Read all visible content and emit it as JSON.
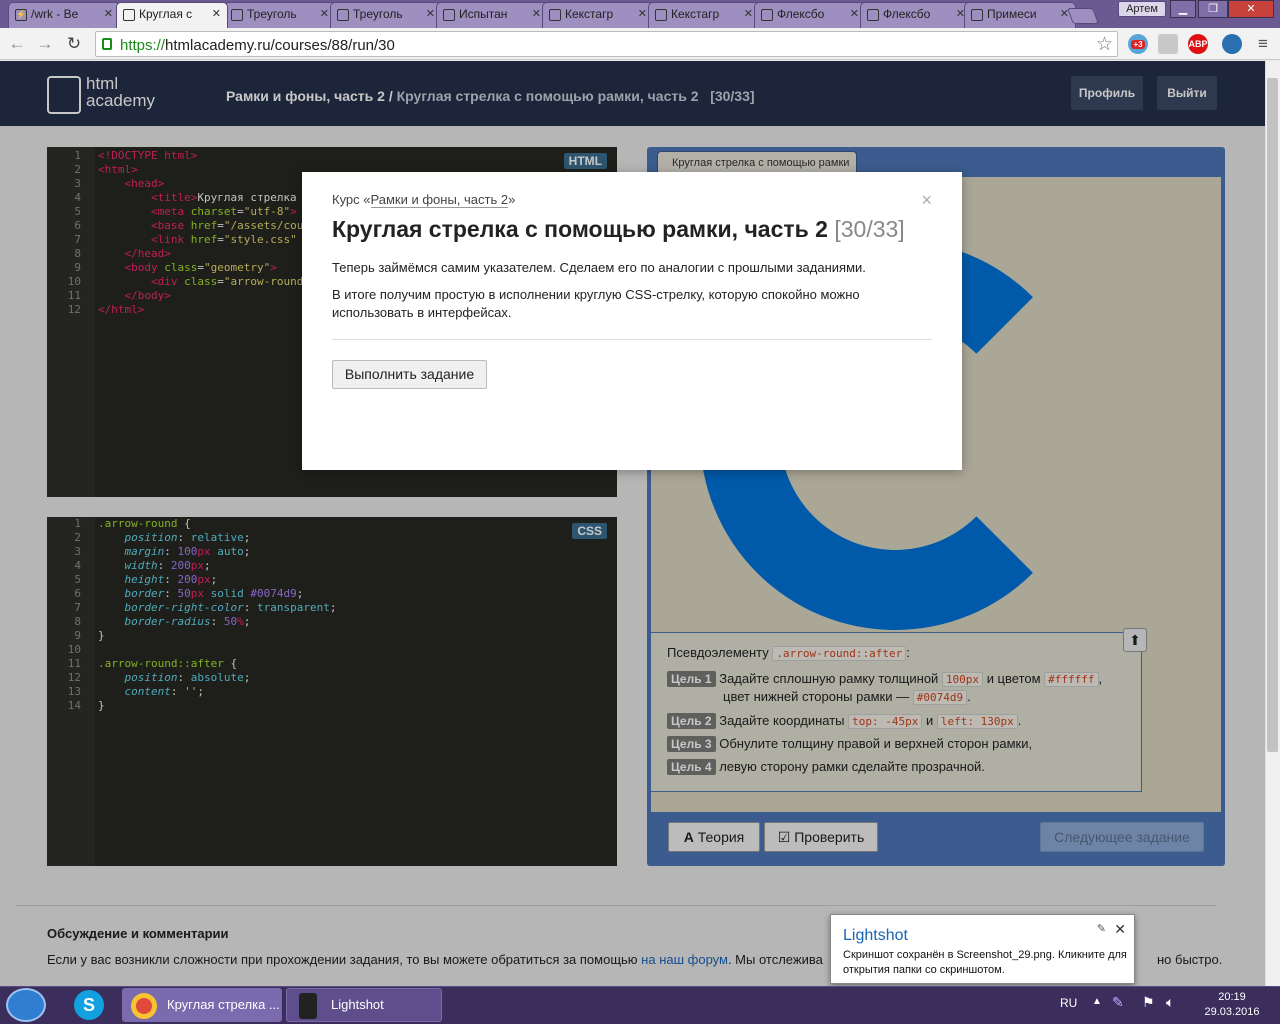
{
  "browser": {
    "tabs": [
      {
        "title": "/wrk - Ве"
      },
      {
        "title": "Круглая с",
        "active": true
      },
      {
        "title": "Треуголь"
      },
      {
        "title": "Треуголь"
      },
      {
        "title": "Испытан"
      },
      {
        "title": "Кекстагр"
      },
      {
        "title": "Кекстагр"
      },
      {
        "title": "Флексбо"
      },
      {
        "title": "Флексбо"
      },
      {
        "title": "Примеси"
      }
    ],
    "user_label": "Артем",
    "url_scheme": "https://",
    "url_rest": "htmlacademy.ru/courses/88/run/30",
    "ext_badge": "+3",
    "abp_label": "ABP"
  },
  "site": {
    "logo_line1": "html",
    "logo_line2": "academy",
    "breadcrumb_course": "Рамки и фоны, часть 2",
    "breadcrumb_sep": " / ",
    "breadcrumb_task": "Круглая стрелка с помощью рамки, часть 2",
    "breadcrumb_count": "[30/33]",
    "profile_button": "Профиль",
    "logout_button": "Выйти"
  },
  "html_editor": {
    "lang": "HTML",
    "line_numbers": [
      "1",
      "2",
      "3",
      "4",
      "5",
      "6",
      "7",
      "8",
      "9",
      "10",
      "11",
      "12"
    ]
  },
  "css_editor": {
    "lang": "CSS",
    "line_numbers": [
      "1",
      "2",
      "3",
      "4",
      "5",
      "6",
      "7",
      "8",
      "9",
      "10",
      "11",
      "12",
      "13",
      "14"
    ]
  },
  "preview": {
    "tab_label": "Круглая стрелка с помощью рамки",
    "arrow_color": "#0074d9",
    "intro_text": "Псевдоэлементу",
    "intro_code": ".arrow-round::after",
    "intro_tail": ":",
    "goals": [
      {
        "label": "Цель 1",
        "text1": "Задайте сплошную рамку толщиной",
        "code1": "100px",
        "text2": "и цветом",
        "code2": "#ffffff",
        "text3": ",",
        "line2_text": "цвет нижней стороны рамки —",
        "line2_code": "#0074d9",
        "line2_tail": "."
      },
      {
        "label": "Цель 2",
        "text1": "Задайте координаты",
        "code1": "top: -45px",
        "text2": "и",
        "code2": "left: 130px",
        "text3": "."
      },
      {
        "label": "Цель 3",
        "text1": "Обнулите толщину правой и верхней сторон рамки,"
      },
      {
        "label": "Цель 4",
        "text1": "левую сторону рамки сделайте прозрачной."
      }
    ],
    "theory_button": "Теория",
    "check_button": "Проверить",
    "next_button": "Следующее задание"
  },
  "discussion": {
    "heading": "Обсуждение и комментарии",
    "text_start": "Если у вас возникли сложности при прохождении задания, то вы можете обратиться за помощью",
    "link": "на наш форум",
    "text_end": ". Мы отслежива",
    "text_tail": "но быстро."
  },
  "modal": {
    "course_prefix": "Курс «",
    "course_name": "Рамки и фоны, часть 2",
    "course_suffix": "»",
    "title": "Круглая стрелка с помощью рамки, часть 2",
    "count": "[30/33]",
    "para1": "Теперь займёмся самим указателем. Сделаем его по аналогии с прошлыми заданиями.",
    "para2": "В итоге получим простую в исполнении круглую CSS-стрелку, которую спокойно можно использовать в интерфейсах.",
    "button": "Выполнить задание",
    "close": "×"
  },
  "lightshot": {
    "title": "Lightshot",
    "message": "Скриншот сохранён в Screenshot_29.png. Кликните для открытия папки со скриншотом."
  },
  "taskbar": {
    "items": [
      {
        "label": "Круглая стрелка ..."
      },
      {
        "label": "Lightshot"
      }
    ],
    "lang": "RU",
    "time": "20:19",
    "date": "29.03.2016"
  }
}
